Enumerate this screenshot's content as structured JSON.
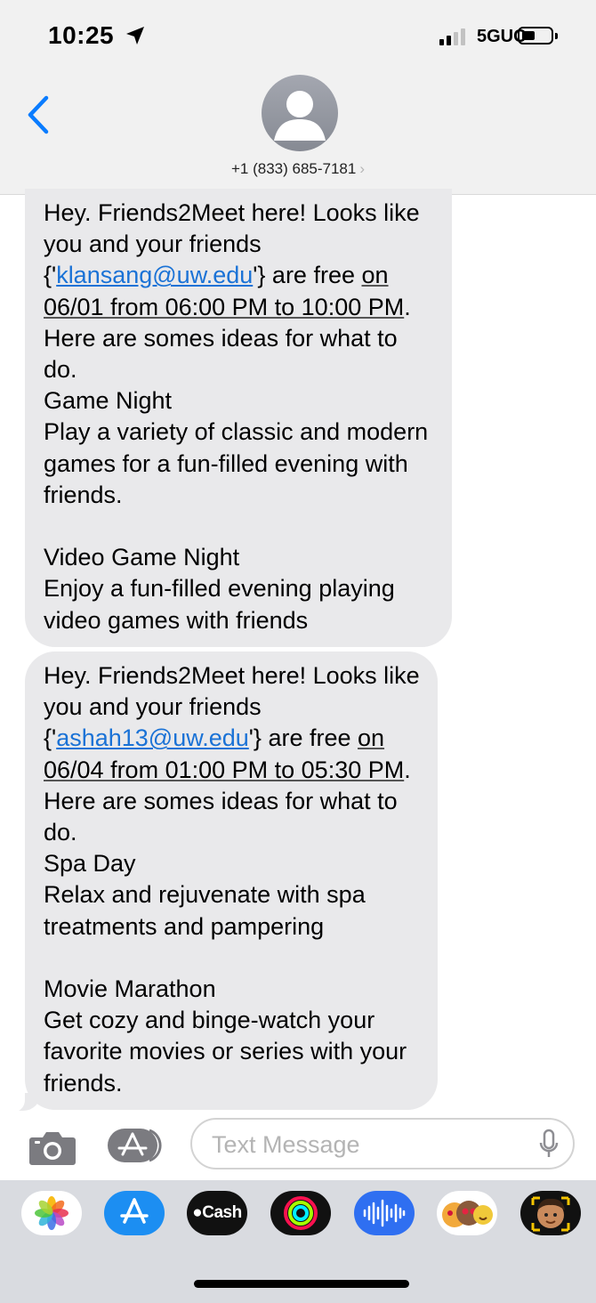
{
  "status_bar": {
    "time": "10:25",
    "network": "5GUC",
    "battery_level": 0.45
  },
  "header": {
    "contact": "+1 (833) 685-7181",
    "chevron": "›"
  },
  "messages": [
    {
      "intro": "Hey. Friends2Meet here! Looks like you and your friends\n{'",
      "email": "klansang@uw.edu",
      "after_email": "'} are free ",
      "when": "on 06/01 from 06:00 PM to 10:00 PM",
      "body": ". Here are somes ideas for what to do.\nGame Night\nPlay a variety of classic and modern games for a fun-filled evening with friends.\n\nVideo Game Night\nEnjoy a fun-filled evening playing video games with friends"
    },
    {
      "intro": "Hey. Friends2Meet here! Looks like you and your friends\n{'",
      "email": "ashah13@uw.edu",
      "after_email": "'} are free ",
      "when": "on 06/04 from 01:00 PM to 05:30 PM",
      "body": ". Here are somes ideas for what to do.\nSpa Day\nRelax and rejuvenate with spa treatments and pampering\n\nMovie Marathon\nGet cozy and binge-watch your favorite movies or series with your friends."
    }
  ],
  "composer": {
    "placeholder": "Text Message"
  },
  "app_drawer": {
    "items": [
      "photos-icon",
      "app-store-icon",
      "cash-app-icon",
      "fitness-icon",
      "audio-message-icon",
      "memoji-stickers-icon",
      "memoji-icon"
    ],
    "cash_label": "Cash"
  },
  "colors": {
    "bubble": "#e9e9eb",
    "link": "#1a72d6",
    "accent_blue": "#0a7cff"
  }
}
